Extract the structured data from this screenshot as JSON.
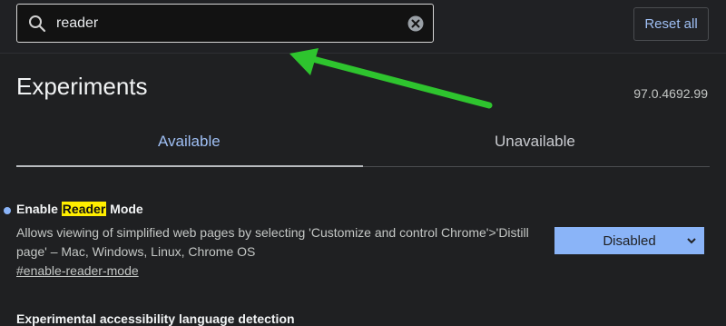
{
  "search": {
    "value": "reader"
  },
  "toolbar": {
    "reset_label": "Reset all"
  },
  "header": {
    "title": "Experiments",
    "version": "97.0.4692.99"
  },
  "tabs": [
    {
      "label": "Available",
      "active": true
    },
    {
      "label": "Unavailable",
      "active": false
    }
  ],
  "flags": [
    {
      "title_before": "Enable ",
      "title_highlight": "Reader",
      "title_after": " Mode",
      "description": "Allows viewing of simplified web pages by selecting 'Customize and control Chrome'>'Distill page' – Mac, Windows, Linux, Chrome OS",
      "link": "#enable-reader-mode",
      "select_value": "Disabled"
    },
    {
      "title": "Experimental accessibility language detection"
    }
  ],
  "colors": {
    "accent": "#8ab4f8",
    "highlight": "#ffee00",
    "annotation_arrow": "#2ec42e",
    "background": "#1f2022"
  }
}
